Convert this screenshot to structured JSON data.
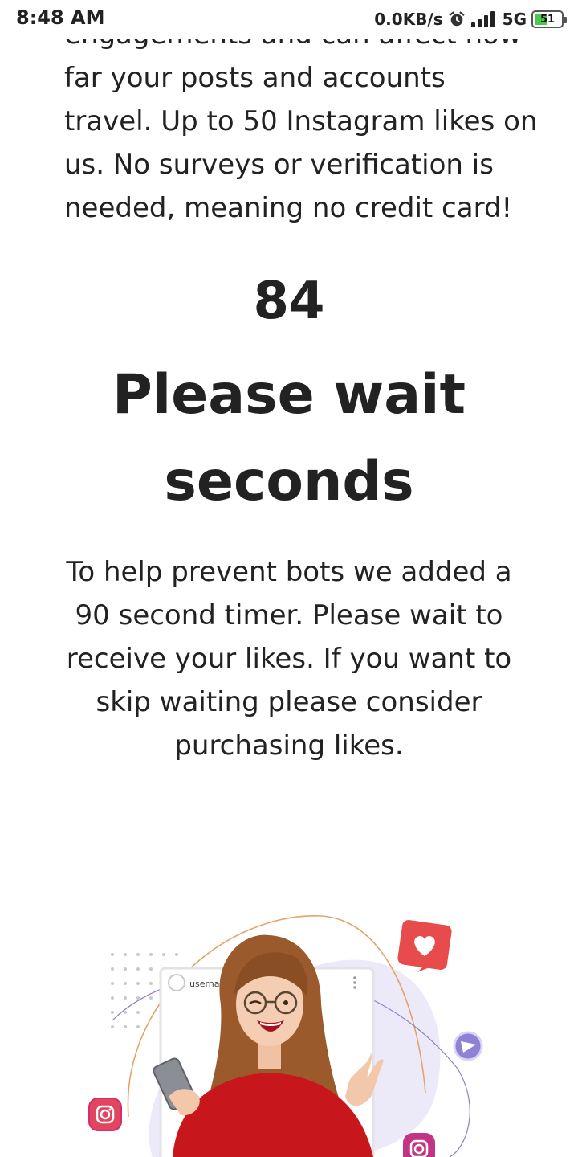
{
  "status_bar": {
    "time": "8:48 AM",
    "net_speed": "0.0KB/s",
    "network": "5G",
    "battery": "51",
    "battery_level": 0.51,
    "icons": [
      "alarm-icon",
      "signal-icon",
      "battery-icon"
    ]
  },
  "intro": {
    "lines": [
      "engagements and can affect how",
      "far your posts and accounts",
      "travel. Up to 50 Instagram likes on",
      "us. No surveys or verification is",
      "needed, meaning no credit card!"
    ]
  },
  "timer": {
    "count": "84",
    "headline_line1": "Please wait",
    "headline_line2": "seconds"
  },
  "note": {
    "lines": [
      "To help prevent bots we added a",
      "90 second timer. Please wait to",
      "receive your likes. If you want to",
      "skip waiting please consider",
      "purchasing likes."
    ]
  },
  "hero": {
    "post_username": "usernam",
    "icons": [
      "heart-icon",
      "send-icon",
      "instagram-icon"
    ],
    "colors": {
      "sweater": "#c8161d",
      "heart_badge": "#e84b4b",
      "blob": "#eceaf8",
      "outline": "#e3a46a"
    }
  }
}
